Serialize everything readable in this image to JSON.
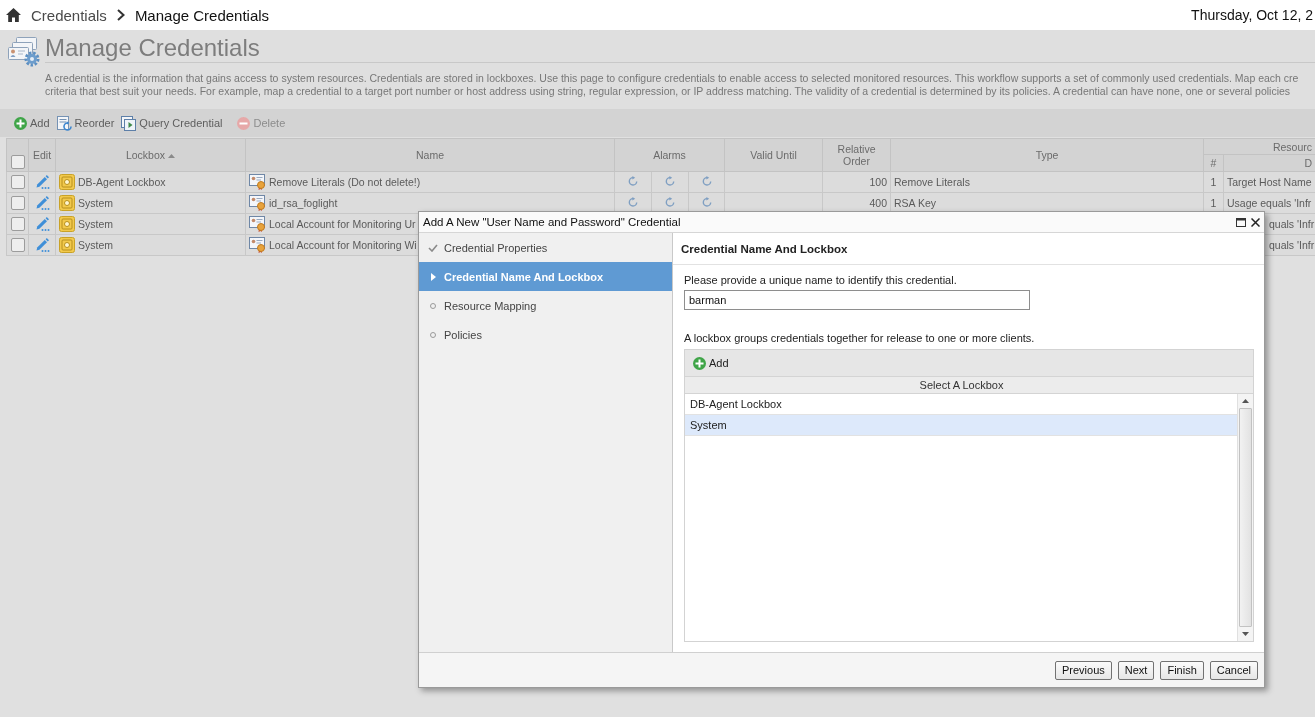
{
  "breadcrumb": {
    "items": [
      {
        "label": "Credentials",
        "current": false
      },
      {
        "label": "Manage Credentials",
        "current": true
      }
    ],
    "date": "Thursday, Oct 12, 2"
  },
  "page": {
    "title": "Manage Credentials",
    "description_lines": [
      "A credential is the information that gains access to system resources. Credentials are stored in lockboxes. Use this page to configure credentials to enable access to selected monitored resources. This workflow supports a set of commonly used credentials. Map each cre",
      "criteria that best suit your needs. For example, map a credential to a target port number or host address using string, regular expression, or IP address matching. The validity of a credential is determined by its policies. A credential can have none, one or several policies"
    ]
  },
  "toolbar": [
    {
      "label": "Add",
      "kind": "add",
      "disabled": false
    },
    {
      "label": "Reorder",
      "kind": "reorder",
      "disabled": false
    },
    {
      "label": "Query Credential",
      "kind": "query",
      "disabled": false
    },
    {
      "label": "Delete",
      "kind": "delete",
      "disabled": true
    }
  ],
  "table": {
    "select_all": {
      "checked": false
    },
    "columns": [
      {
        "label": "Edit"
      },
      {
        "label": "Lockbox",
        "sorted": true
      },
      {
        "label": "Name"
      },
      {
        "label": "Alarms"
      },
      {
        "label": "Valid Until"
      },
      {
        "label": "Relative Order"
      },
      {
        "label": "Type"
      },
      {
        "label": "Resourc",
        "children": [
          {
            "label": "#"
          },
          {
            "label": "D"
          }
        ]
      }
    ],
    "rows": [
      {
        "checked": false,
        "lockbox": "DB-Agent Lockbox",
        "name": "Remove Literals (Do not delete!)",
        "alarms": [
          {
            "kind": "refresh"
          },
          {
            "kind": "refresh"
          },
          {
            "kind": "refresh"
          }
        ],
        "relative_order": "100",
        "type": "Remove Literals",
        "resource_count": "1",
        "resource_description": "Target Host Name"
      },
      {
        "checked": false,
        "lockbox": "System",
        "name": "id_rsa_foglight",
        "alarms": [
          {
            "kind": "refresh"
          },
          {
            "kind": "refresh"
          },
          {
            "kind": "refresh"
          }
        ],
        "relative_order": "400",
        "type": "RSA Key",
        "resource_count": "1",
        "resource_description": "Usage equals 'Infr"
      },
      {
        "checked": false,
        "lockbox": "System",
        "name": "Local Account for Monitoring Ur",
        "resource_description": "quals 'Infr"
      },
      {
        "checked": false,
        "lockbox": "System",
        "name": "Local Account for Monitoring Wi",
        "resource_description": "quals 'Infr"
      }
    ]
  },
  "dialog": {
    "title": "Add A New \"User Name and Password\" Credential",
    "steps": [
      {
        "label": "Credential Properties",
        "selected": false,
        "kind": "done"
      },
      {
        "label": "Credential Name And Lockbox",
        "selected": true,
        "kind": "current"
      },
      {
        "label": "Resource Mapping",
        "selected": false,
        "kind": "pending"
      },
      {
        "label": "Policies",
        "selected": false,
        "kind": "pending"
      }
    ],
    "heading": "Credential Name And Lockbox",
    "name_prompt": "Please provide a unique name to identify this credential.",
    "name_field": {
      "value": "barman"
    },
    "lockbox_prompt": "A lockbox groups credentials together for release to one or more clients.",
    "lockbox_grid": {
      "add_label": "Add",
      "header": "Select A Lockbox",
      "rows": [
        {
          "label": "DB-Agent Lockbox",
          "selected": false
        },
        {
          "label": "System",
          "selected": true
        }
      ]
    },
    "buttons": [
      {
        "label": "Previous"
      },
      {
        "label": "Next"
      },
      {
        "label": "Finish"
      },
      {
        "label": "Cancel"
      }
    ]
  }
}
